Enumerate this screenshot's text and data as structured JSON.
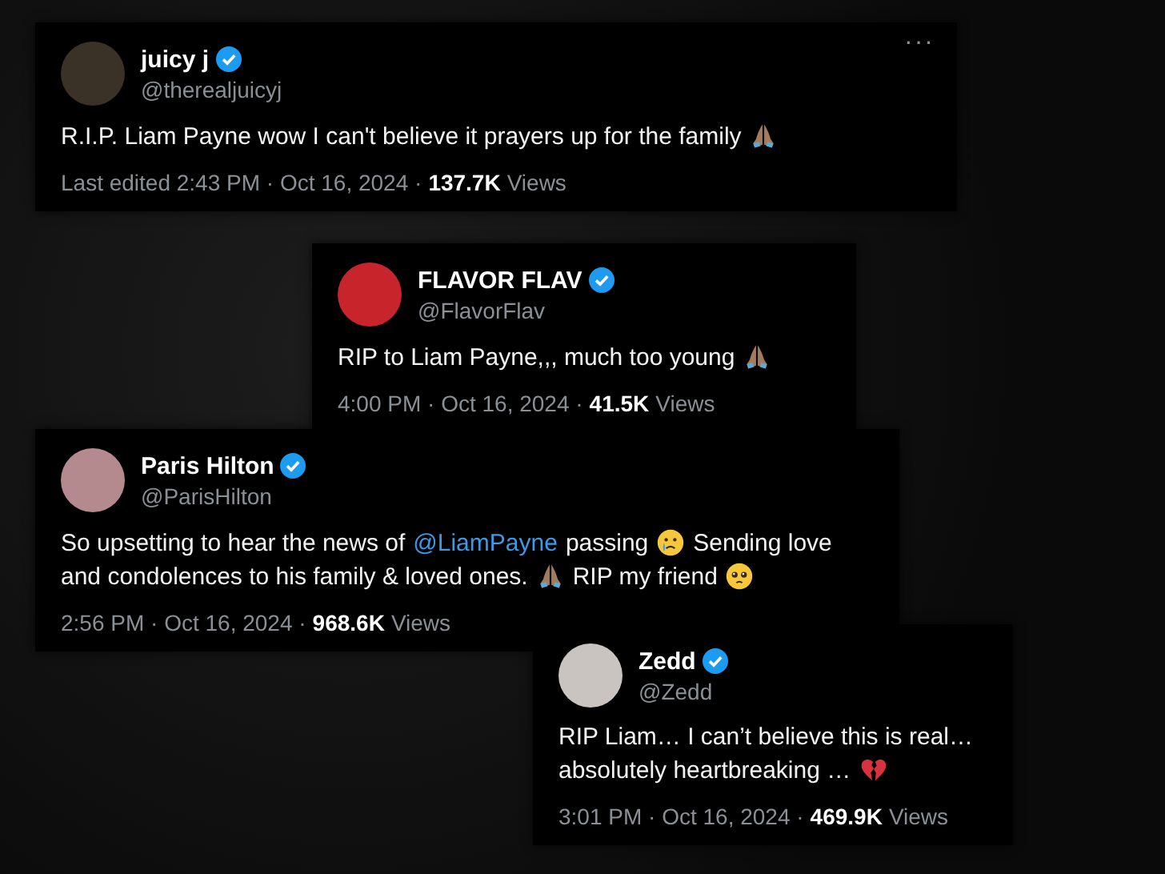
{
  "tweets": [
    {
      "name": "juicy j",
      "handle": "@therealjuicyj",
      "verified": true,
      "menu": "···",
      "lines": [
        [
          {
            "kind": "text",
            "text": "R.I.P. Liam Payne wow I can't believe it  prayers up for the family"
          },
          {
            "kind": "pray"
          }
        ]
      ],
      "time": "Last edited 2:43 PM · Oct 16, 2024 ·",
      "views_count": "137.7K",
      "views_label": "Views"
    },
    {
      "name": "FLAVOR FLAV",
      "handle": "@FlavorFlav",
      "verified": true,
      "lines": [
        [
          {
            "kind": "text",
            "text": "RIP to Liam Payne,,, much too young"
          },
          {
            "kind": "pray"
          }
        ]
      ],
      "time": "4:00 PM · Oct 16, 2024 ·",
      "views_count": "41.5K",
      "views_label": "Views"
    },
    {
      "name": "Paris Hilton",
      "handle": "@ParisHilton",
      "verified": true,
      "lines": [
        [
          {
            "kind": "text",
            "text": "So upsetting to hear the news of"
          },
          {
            "kind": "mention",
            "text": "@LiamPayne"
          },
          {
            "kind": "text",
            "text": "passing"
          },
          {
            "kind": "cry"
          },
          {
            "kind": "text",
            "text": "Sending love"
          }
        ],
        [
          {
            "kind": "text",
            "text": "and condolences to his family & loved ones."
          },
          {
            "kind": "pray"
          },
          {
            "kind": "text",
            "text": "RIP my friend"
          },
          {
            "kind": "plead"
          }
        ]
      ],
      "time": "2:56 PM · Oct 16, 2024 ·",
      "views_count": "968.6K",
      "views_label": "Views"
    },
    {
      "name": "Zedd",
      "handle": "@Zedd",
      "verified": true,
      "lines": [
        [
          {
            "kind": "text",
            "text": "RIP Liam… I can’t believe this is real…"
          }
        ],
        [
          {
            "kind": "text",
            "text": "absolutely heartbreaking …"
          },
          {
            "kind": "broken-heart"
          }
        ]
      ],
      "time": "3:01 PM · Oct 16, 2024 ·",
      "views_count": "469.9K",
      "views_label": "Views"
    }
  ]
}
